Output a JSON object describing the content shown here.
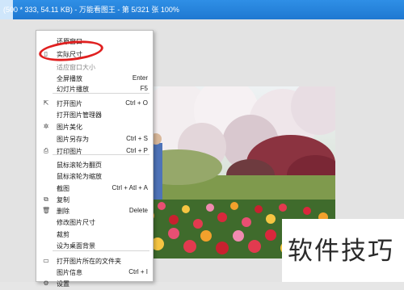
{
  "window": {
    "title": "(500 * 333, 54.11 KB) - 万能看图王 - 第 5/321 张 100%"
  },
  "context_menu": {
    "items": [
      {
        "name": "restore-window",
        "label": "还原窗口",
        "shortcut": "",
        "icon": "",
        "faded": false
      },
      {
        "name": "actual-size",
        "label": "实际尺寸",
        "shortcut": "",
        "icon": "square-icon",
        "faded": false
      },
      {
        "name": "fit-window",
        "label": "适应窗口大小",
        "shortcut": "",
        "icon": "",
        "faded": true
      },
      {
        "name": "fullscreen",
        "label": "全屏播放",
        "shortcut": "Enter",
        "icon": "",
        "faded": false
      },
      {
        "name": "slideshow",
        "label": "幻灯片播放",
        "shortcut": "F5",
        "icon": "",
        "faded": false
      },
      {
        "name": "open-image",
        "label": "打开图片",
        "shortcut": "Ctrl + O",
        "icon": "open-icon",
        "faded": false
      },
      {
        "name": "open-manager",
        "label": "打开图片管理器",
        "shortcut": "",
        "icon": "",
        "faded": false
      },
      {
        "name": "beautify",
        "label": "图片美化",
        "shortcut": "",
        "icon": "magic-icon",
        "faded": false
      },
      {
        "name": "save-as",
        "label": "图片另存为",
        "shortcut": "Ctrl + S",
        "icon": "",
        "faded": false
      },
      {
        "name": "print",
        "label": "打印图片",
        "shortcut": "Ctrl + P",
        "icon": "printer-icon",
        "faded": false
      },
      {
        "name": "wheel-page",
        "label": "鼠标滚轮为翻页",
        "shortcut": "",
        "icon": "",
        "faded": false
      },
      {
        "name": "wheel-zoom",
        "label": "鼠标滚轮为缩放",
        "shortcut": "",
        "icon": "",
        "faded": false
      },
      {
        "name": "screenshot",
        "label": "截图",
        "shortcut": "Ctrl + Atl + A",
        "icon": "",
        "faded": false
      },
      {
        "name": "copy",
        "label": "复制",
        "shortcut": "",
        "icon": "copy-icon",
        "faded": false
      },
      {
        "name": "delete",
        "label": "删除",
        "shortcut": "Delete",
        "icon": "trash-icon",
        "faded": false
      },
      {
        "name": "resize",
        "label": "修改图片尺寸",
        "shortcut": "",
        "icon": "",
        "faded": false
      },
      {
        "name": "crop",
        "label": "裁剪",
        "shortcut": "",
        "icon": "",
        "faded": false
      },
      {
        "name": "set-wallpaper",
        "label": "设为桌面背景",
        "shortcut": "",
        "icon": "",
        "faded": false
      },
      {
        "name": "open-folder",
        "label": "打开图片所在的文件夹",
        "shortcut": "",
        "icon": "folder-icon",
        "faded": false
      },
      {
        "name": "image-info",
        "label": "图片信息",
        "shortcut": "Ctrl + I",
        "icon": "",
        "faded": false
      },
      {
        "name": "settings",
        "label": "设置",
        "shortcut": "",
        "icon": "gear-icon",
        "faded": false
      }
    ]
  },
  "watermark": {
    "text": "软件技巧"
  },
  "colors": {
    "titlebar": "#1f78d1",
    "highlight": "#e02020",
    "menu_bg": "#ffffff"
  }
}
